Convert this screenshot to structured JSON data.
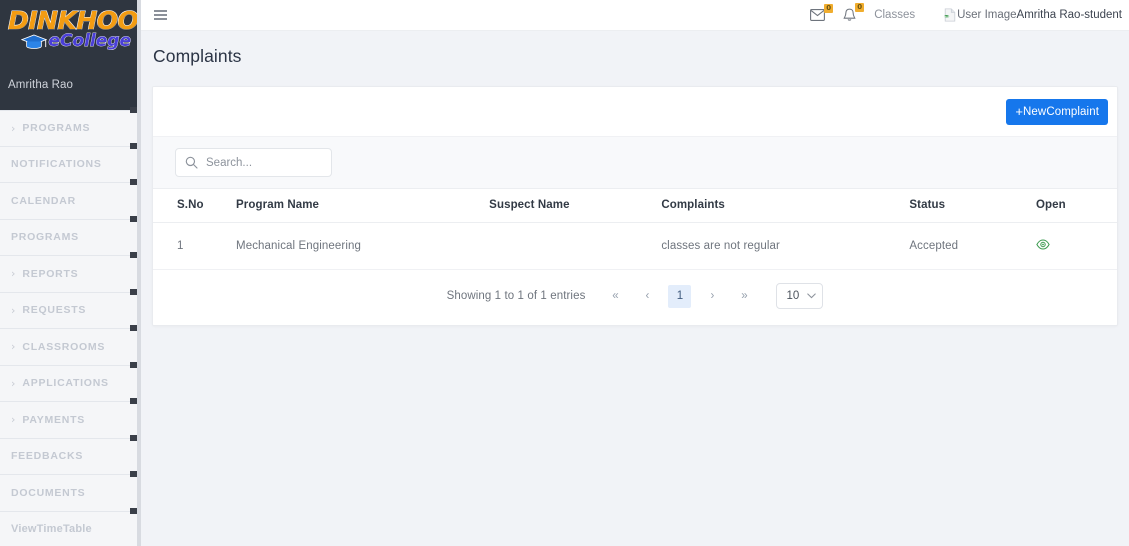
{
  "sidebar": {
    "logo": {
      "primary": "DINKHOO!",
      "secondary": "eCollege",
      "cap_icon": "graduation-cap-icon"
    },
    "username": "Amritha Rao",
    "items": [
      {
        "label": "PROGRAMS",
        "caret": "›",
        "expandable": true
      },
      {
        "label": "NOTIFICATIONS",
        "caret": "",
        "expandable": false
      },
      {
        "label": "CALENDAR",
        "caret": "",
        "expandable": false
      },
      {
        "label": "PROGRAMS",
        "caret": "",
        "expandable": false
      },
      {
        "label": "REPORTS",
        "caret": "›",
        "expandable": true
      },
      {
        "label": "REQUESTS",
        "caret": "›",
        "expandable": true
      },
      {
        "label": "CLASSROOMS",
        "caret": "›",
        "expandable": true
      },
      {
        "label": "APPLICATIONS",
        "caret": "›",
        "expandable": true
      },
      {
        "label": "PAYMENTS",
        "caret": "›",
        "expandable": true
      },
      {
        "label": "FEEDBACKS",
        "caret": "",
        "expandable": false
      },
      {
        "label": "DOCUMENTS",
        "caret": "",
        "expandable": false
      },
      {
        "label": "ViewTimeTable",
        "caret": "",
        "expandable": false,
        "mixed_case": true
      }
    ]
  },
  "topbar": {
    "menu_icon": "hamburger-icon",
    "mail": {
      "icon": "envelope-icon",
      "badge": "0"
    },
    "bell": {
      "icon": "bell-icon",
      "badge": "0"
    },
    "classes_link": "Classes",
    "avatar_alt": "User Image",
    "user_label": "Amritha Rao-student"
  },
  "page": {
    "title": "Complaints"
  },
  "toolbar": {
    "new_complaint_plus": "+",
    "new_complaint_label": "NewComplaint"
  },
  "search": {
    "placeholder": "Search...",
    "value": "",
    "icon": "search-icon"
  },
  "table": {
    "columns": [
      "S.No",
      "Program Name",
      "Suspect Name",
      "Complaints",
      "Status",
      "Open"
    ],
    "rows": [
      {
        "sno": "1",
        "program_name": "Mechanical Engineering",
        "suspect_name": "",
        "complaints": "classes are not regular",
        "status": "Accepted",
        "open_icon": "eye-icon"
      }
    ]
  },
  "pagination": {
    "showing": "Showing 1 to 1 of 1 entries",
    "first": "«",
    "prev": "‹",
    "current_page": "1",
    "next": "›",
    "last": "»",
    "page_size": "10",
    "chevron": "⌄"
  },
  "colors": {
    "accent_blue": "#1677ec",
    "badge_orange": "#f0ad2e",
    "sidebar_dark": "#2f3640",
    "eye_green": "#3a9a4e",
    "logo_orange": "#f39c12",
    "logo_blue": "#4a3fd6"
  }
}
